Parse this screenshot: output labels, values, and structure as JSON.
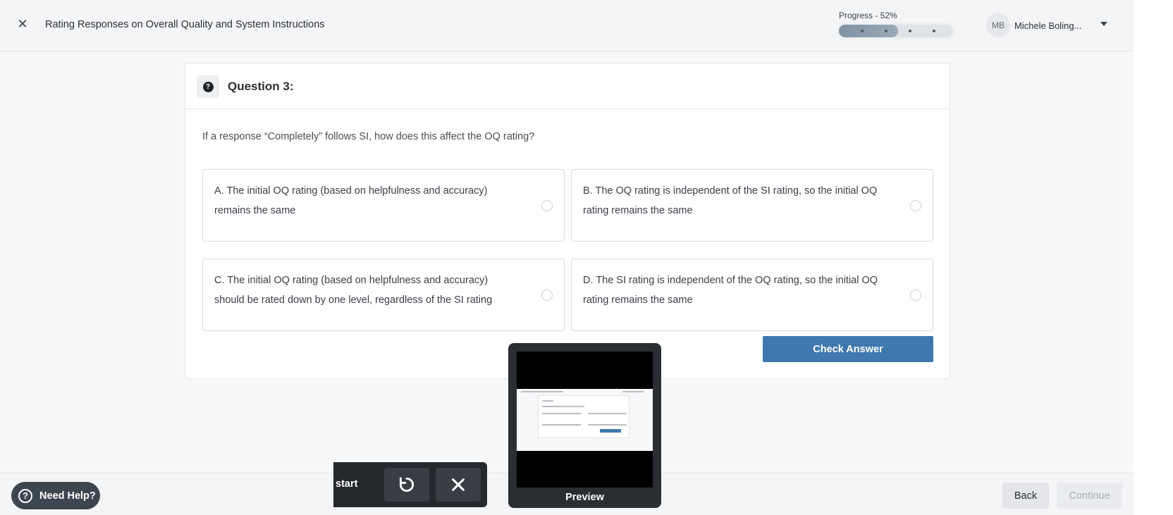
{
  "header": {
    "close_icon": "close-icon",
    "title": "Rating Responses on Overall Quality and System Instructions",
    "progress": {
      "label": "Progress - 52%",
      "value_percent": 52,
      "steps": 4
    },
    "user": {
      "initials": "MB",
      "name": "Michele Boling..."
    }
  },
  "question": {
    "icon": "question-icon",
    "title": "Question 3:",
    "prompt": "If a response “Completely” follows SI, how does this affect the OQ rating?",
    "options": [
      {
        "text": "A. The initial OQ rating (based on helpfulness and accuracy) remains the same",
        "selected": false
      },
      {
        "text": "B. The OQ rating is independent of the SI rating, so the initial OQ rating remains the same",
        "selected": false
      },
      {
        "text": "C. The initial OQ rating (based on helpfulness and accuracy) should be rated down by one level, regardless of the SI rating",
        "selected": false
      },
      {
        "text": "D. The SI rating is independent of the OQ rating, so the initial OQ rating remains the same",
        "selected": false
      }
    ],
    "check_label": "Check Answer"
  },
  "footer": {
    "help_label": "Need Help?",
    "back_label": "Back",
    "continue_label": "Continue"
  },
  "recorder": {
    "label": "start",
    "restart_icon": "restart-icon",
    "cancel_icon": "cancel-icon",
    "preview_label": "Preview"
  },
  "colors": {
    "accent": "#3f78ad",
    "help_bg": "#3c4651",
    "recorder_bg": "#25282c"
  }
}
